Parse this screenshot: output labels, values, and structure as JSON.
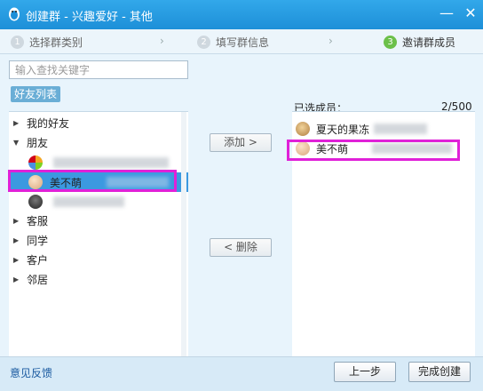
{
  "window": {
    "title": "创建群 - 兴趣爱好 - 其他"
  },
  "titlebar_buttons": {
    "minimize": "—",
    "close": "✕"
  },
  "steps": [
    {
      "num": "1",
      "label": "选择群类别",
      "active": false
    },
    {
      "num": "2",
      "label": "填写群信息",
      "active": false
    },
    {
      "num": "3",
      "label": "邀请群成员",
      "active": true
    }
  ],
  "step_arrow": "›",
  "search": {
    "placeholder": "输入查找关键字"
  },
  "friend_tab": "好友列表",
  "tree": {
    "groups": [
      {
        "label": "我的好友",
        "expanded": false
      },
      {
        "label": "朋友",
        "expanded": true
      },
      {
        "label": "客服",
        "expanded": false
      },
      {
        "label": "同学",
        "expanded": false
      },
      {
        "label": "客户",
        "expanded": false
      },
      {
        "label": "邻居",
        "expanded": false
      }
    ],
    "friends": [
      {
        "name": ""
      },
      {
        "name": "美不萌"
      },
      {
        "name": ""
      }
    ]
  },
  "buttons": {
    "add": "添加 >",
    "remove": "< 删除",
    "prev": "上一步",
    "done": "完成创建"
  },
  "selected_panel": {
    "label": "已选成员：",
    "count": "2/500",
    "members": [
      {
        "name": "夏天的果冻"
      },
      {
        "name": "美不萌"
      }
    ]
  },
  "footer": {
    "feedback": "意见反馈"
  },
  "colors": {
    "titlebar": "#1d8fd8",
    "highlight": "#e021d8",
    "selected_row": "#3c99e0",
    "step_active": "#6cc04a"
  }
}
